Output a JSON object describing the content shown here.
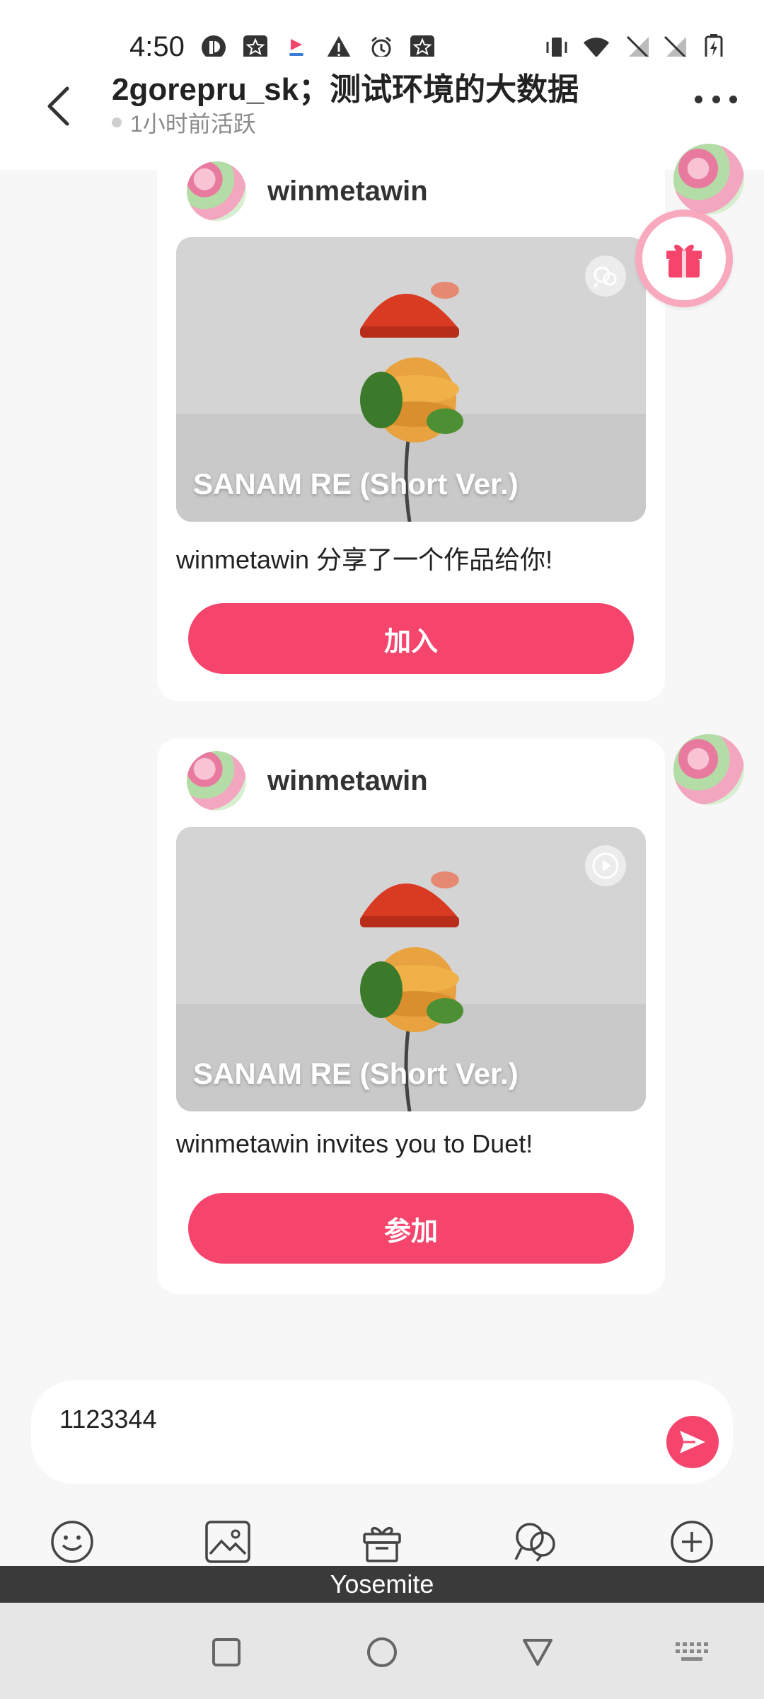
{
  "status_bar": {
    "time": "4:50",
    "icons": [
      "p-icon",
      "star-icon",
      "app-icon",
      "warning-icon",
      "alarm-icon",
      "star-icon",
      "vibrate-icon",
      "wifi-icon",
      "no-sim-icon",
      "no-sim-icon",
      "battery-charging-icon"
    ]
  },
  "header": {
    "title": "2gorepru_sk；测试环境的大数据",
    "status": "1小时前活跃"
  },
  "messages": [
    {
      "username": "winmetawin",
      "thumbnail_caption": "SANAM RE (Short Ver.)",
      "thumbnail_badge": "duet-icon",
      "text": "winmetawin 分享了一个作品给你!",
      "button_label": "加入"
    },
    {
      "username": "winmetawin",
      "thumbnail_caption": "SANAM RE (Short Ver.)",
      "thumbnail_badge": "play-icon",
      "text": "winmetawin invites you to Duet!",
      "button_label": "参加"
    }
  ],
  "input": {
    "value": "1123344"
  },
  "toolbar": {
    "icons": [
      "emoji-icon",
      "image-icon",
      "gift-icon",
      "duet-icon",
      "add-icon"
    ]
  },
  "ime": {
    "label": "Yosemite"
  },
  "colors": {
    "accent": "#f5456d",
    "background": "#f7f7f7"
  }
}
